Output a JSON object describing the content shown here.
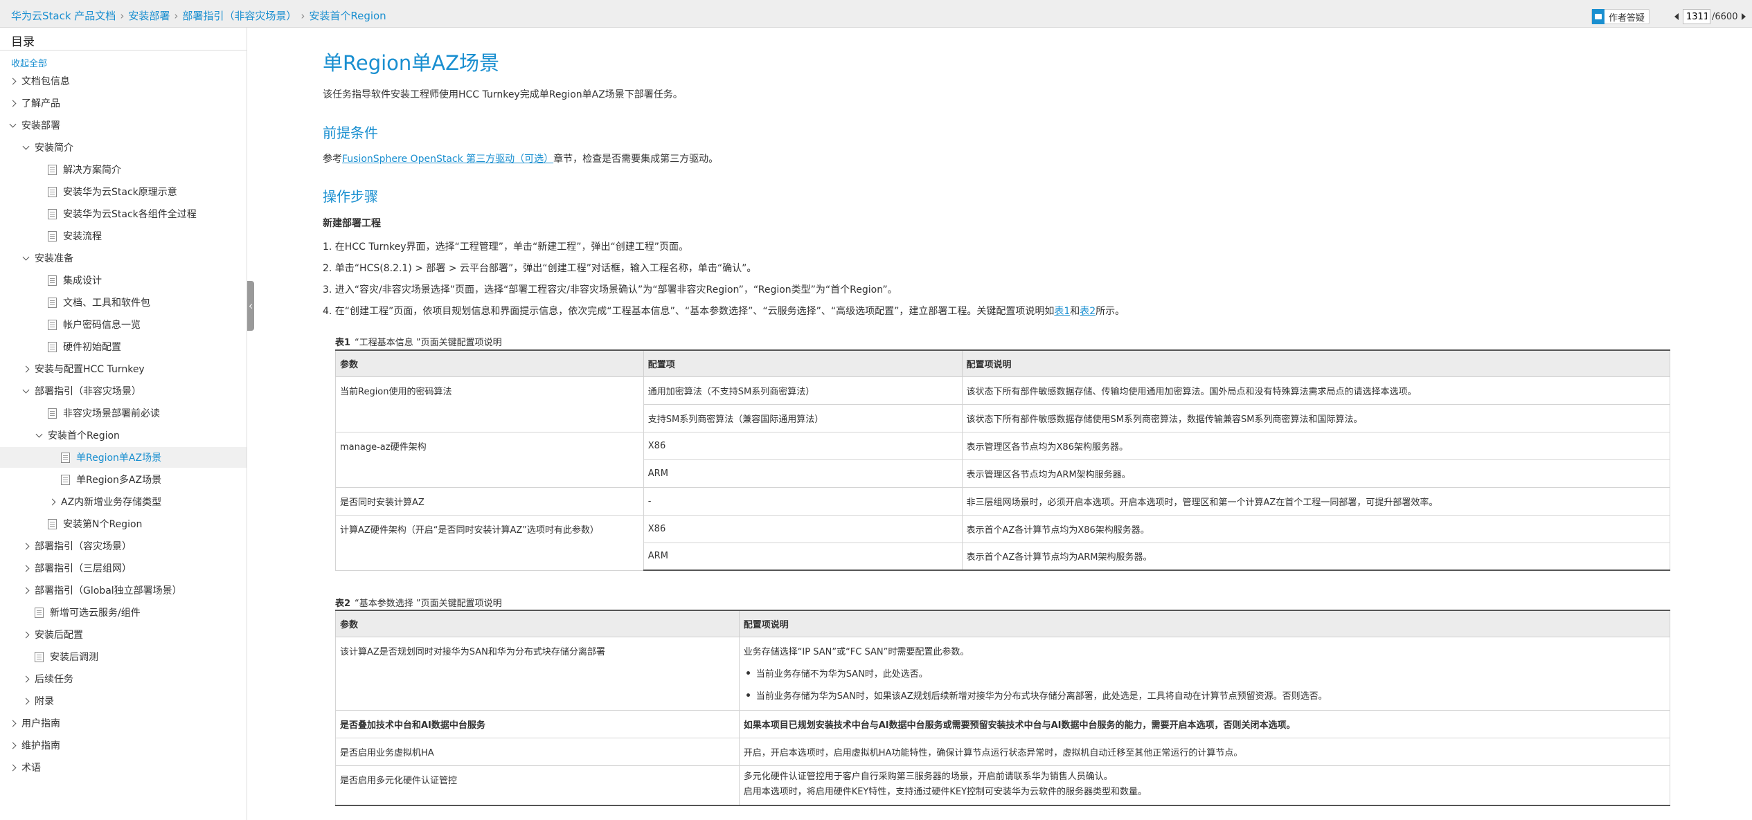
{
  "breadcrumb": [
    "华为云Stack 产品文档",
    "安装部署",
    "部署指引（非容灾场景）",
    "安装首个Region"
  ],
  "toolbar": {
    "feedback_label": "作者答疑",
    "page_current": "1311",
    "page_total": "/6600"
  },
  "toc": {
    "title": "目录",
    "collapse_all": "收起全部",
    "items": [
      {
        "label": "文档包信息",
        "icon": "chevron-right"
      },
      {
        "label": "了解产品",
        "icon": "chevron-right"
      },
      {
        "label": "安装部署",
        "icon": "chevron-down"
      },
      {
        "label": "安装简介",
        "icon": "chevron-down"
      },
      {
        "label": "解决方案简介",
        "icon": "doc"
      },
      {
        "label": "安装华为云Stack原理示意",
        "icon": "doc"
      },
      {
        "label": "安装华为云Stack各组件全过程",
        "icon": "doc"
      },
      {
        "label": "安装流程",
        "icon": "doc"
      },
      {
        "label": "安装准备",
        "icon": "chevron-down"
      },
      {
        "label": "集成设计",
        "icon": "doc"
      },
      {
        "label": "文档、工具和软件包",
        "icon": "doc"
      },
      {
        "label": "帐户密码信息一览",
        "icon": "doc"
      },
      {
        "label": "硬件初始配置",
        "icon": "doc"
      },
      {
        "label": "安装与配置HCC Turnkey",
        "icon": "chevron-right"
      },
      {
        "label": "部署指引（非容灾场景）",
        "icon": "chevron-down"
      },
      {
        "label": "非容灾场景部署前必读",
        "icon": "doc"
      },
      {
        "label": "安装首个Region",
        "icon": "chevron-down"
      },
      {
        "label": "单Region单AZ场景",
        "icon": "doc"
      },
      {
        "label": "单Region多AZ场景",
        "icon": "doc"
      },
      {
        "label": "AZ内新增业务存储类型",
        "icon": "chevron-right"
      },
      {
        "label": "安装第N个Region",
        "icon": "doc"
      },
      {
        "label": "部署指引（容灾场景）",
        "icon": "chevron-right"
      },
      {
        "label": "部署指引（三层组网）",
        "icon": "chevron-right"
      },
      {
        "label": "部署指引（Global独立部署场景）",
        "icon": "chevron-right"
      },
      {
        "label": "新增可选云服务/组件",
        "icon": "doc"
      },
      {
        "label": "安装后配置",
        "icon": "chevron-right"
      },
      {
        "label": "安装后调测",
        "icon": "doc"
      },
      {
        "label": "后续任务",
        "icon": "chevron-right"
      },
      {
        "label": "附录",
        "icon": "chevron-right"
      },
      {
        "label": "用户指南",
        "icon": "chevron-right"
      },
      {
        "label": "维护指南",
        "icon": "chevron-right"
      },
      {
        "label": "术语",
        "icon": "chevron-right"
      }
    ]
  },
  "content": {
    "title": "单Region单AZ场景",
    "intro": "该任务指导软件安装工程师使用HCC Turnkey完成单Region单AZ场景下部署任务。",
    "prereq_heading": "前提条件",
    "prereq_prefix": "参考",
    "prereq_link": "FusionSphere OpenStack 第三方驱动（可选）",
    "prereq_suffix": "章节，检查是否需要集成第三方驱动。",
    "steps_heading": "操作步骤",
    "subheading": "新建部署工程",
    "steps": [
      "1. 在HCC Turnkey界面，选择“工程管理”，单击“新建工程”，弹出“创建工程”页面。",
      "2. 单击“HCS(8.2.1) > 部署 > 云平台部署”，弹出“创建工程”对话框，输入工程名称，单击“确认”。",
      "3. 进入“容灾/非容灾场景选择”页面，选择“部署工程容灾/非容灾场景确认”为“部署非容灾Region”，“Region类型”为“首个Region”。"
    ],
    "step4_prefix": "4. 在“创建工程”页面，依项目规划信息和界面提示信息，依次完成“工程基本信息”、“基本参数选择”、“云服务选择”、“高级选项配置”，建立部署工程。关键配置项说明如",
    "step4_link1": "表1",
    "step4_mid": "和",
    "step4_link2": "表2",
    "step4_suffix": "所示。"
  },
  "table1": {
    "caption_no": "表1",
    "caption": "“工程基本信息 ”页面关键配置项说明",
    "headers": [
      "参数",
      "配置项",
      "配置项说明"
    ],
    "rows": [
      {
        "param": "当前Region使用的密码算法",
        "span": 2,
        "items": [
          [
            "通用加密算法（不支持SM系列商密算法）",
            "该状态下所有部件敏感数据存储、传输均使用通用加密算法。国外局点和没有特殊算法需求局点的请选择本选项。"
          ],
          [
            "支持SM系列商密算法（兼容国际通用算法）",
            "该状态下所有部件敏感数据存储使用SM系列商密算法，数据传输兼容SM系列商密算法和国际算法。"
          ]
        ]
      },
      {
        "param": "manage-az硬件架构",
        "span": 2,
        "items": [
          [
            "X86",
            "表示管理区各节点均为X86架构服务器。"
          ],
          [
            "ARM",
            "表示管理区各节点均为ARM架构服务器。"
          ]
        ]
      },
      {
        "param": "是否同时安装计算AZ",
        "span": 1,
        "items": [
          [
            "-",
            "非三层组网场景时，必须开启本选项。开启本选项时，管理区和第一个计算AZ在首个工程一同部署，可提升部署效率。"
          ]
        ]
      },
      {
        "param": "计算AZ硬件架构（开启“是否同时安装计算AZ”选项时有此参数）",
        "span": 2,
        "items": [
          [
            "X86",
            "表示首个AZ各计算节点均为X86架构服务器。"
          ],
          [
            "ARM",
            "表示首个AZ各计算节点均为ARM架构服务器。"
          ]
        ]
      }
    ]
  },
  "table2": {
    "caption_no": "表2",
    "caption": "“基本参数选择 ”页面关键配置项说明",
    "headers": [
      "参数",
      "配置项说明"
    ],
    "rows": [
      {
        "param": "该计算AZ是否规划同时对接华为SAN和华为分布式块存储分离部署",
        "desc": "业务存储选择“IP SAN”或“FC SAN”时需要配置此参数。",
        "bullets": [
          "当前业务存储不为华为SAN时，此处选否。",
          "当前业务存储为华为SAN时，如果该AZ规划后续新增对接华为分布式块存储分离部署，此处选是，工具将自动在计算节点预留资源。否则选否。"
        ]
      },
      {
        "param": "是否叠加技术中台和AI数据中台服务",
        "desc": "如果本项目已规划安装技术中台与AI数据中台服务或需要预留安装技术中台与AI数据中台服务的能力，需要开启本选项，否则关闭本选项。",
        "bold": true
      },
      {
        "param": "是否启用业务虚拟机HA",
        "desc": "开启，开启本选项时，启用虚拟机HA功能特性，确保计算节点运行状态异常时，虚拟机自动迁移至其他正常运行的计算节点。"
      },
      {
        "param": "是否启用多元化硬件认证管控",
        "desc": "多元化硬件认证管控用于客户自行采购第三服务器的场景，开启前请联系华为销售人员确认。",
        "desc2": "启用本选项时，将启用硬件KEY特性，支持通过硬件KEY控制可安装华为云软件的服务器类型和数量。"
      }
    ]
  }
}
